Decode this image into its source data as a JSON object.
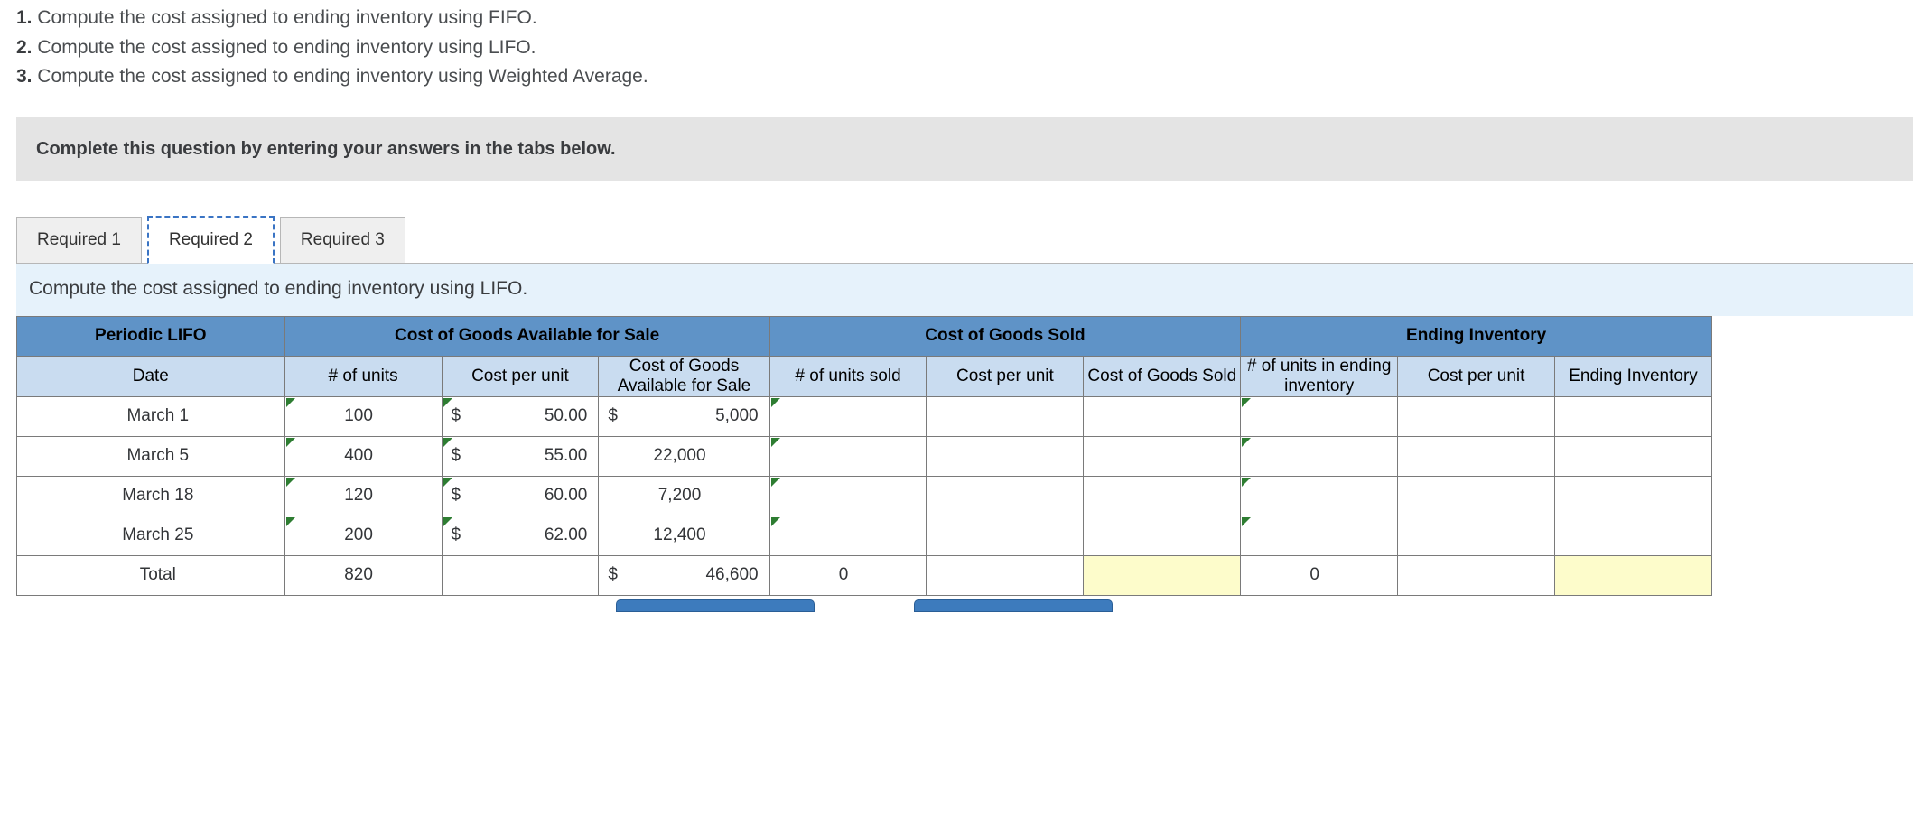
{
  "questions": [
    {
      "num": "1.",
      "text": "Compute the cost assigned to ending inventory using FIFO."
    },
    {
      "num": "2.",
      "text": "Compute the cost assigned to ending inventory using LIFO."
    },
    {
      "num": "3.",
      "text": "Compute the cost assigned to ending inventory using Weighted Average."
    }
  ],
  "instruction": "Complete this question by entering your answers in the tabs below.",
  "tabs": [
    {
      "label": "Required 1",
      "active": false
    },
    {
      "label": "Required 2",
      "active": true
    },
    {
      "label": "Required 3",
      "active": false
    }
  ],
  "prompt": "Compute the cost assigned to ending inventory using LIFO.",
  "table": {
    "corner": "Periodic LIFO",
    "group_headers": [
      "Cost of Goods Available for Sale",
      "Cost of Goods Sold",
      "Ending Inventory"
    ],
    "sub_headers": {
      "date": "Date",
      "units": "# of units",
      "cpu": "Cost per unit",
      "cogs_avail": "Cost of Goods Available for Sale",
      "units_sold": "# of units sold",
      "cpu2": "Cost per unit",
      "cogs": "Cost of Goods Sold",
      "units_end": "# of units in ending inventory",
      "cpu3": "Cost per unit",
      "end_inv": "Ending Inventory"
    },
    "rows": [
      {
        "date": "March 1",
        "units": "100",
        "cpu_sym": "$",
        "cpu": "50.00",
        "avail_sym": "$",
        "avail": "5,000"
      },
      {
        "date": "March 5",
        "units": "400",
        "cpu_sym": "$",
        "cpu": "55.00",
        "avail_sym": "",
        "avail": "22,000"
      },
      {
        "date": "March 18",
        "units": "120",
        "cpu_sym": "$",
        "cpu": "60.00",
        "avail_sym": "",
        "avail": "7,200"
      },
      {
        "date": "March 25",
        "units": "200",
        "cpu_sym": "$",
        "cpu": "62.00",
        "avail_sym": "",
        "avail": "12,400"
      }
    ],
    "total": {
      "label": "Total",
      "units": "820",
      "avail_sym": "$",
      "avail": "46,600",
      "units_sold": "0",
      "units_end": "0"
    }
  }
}
